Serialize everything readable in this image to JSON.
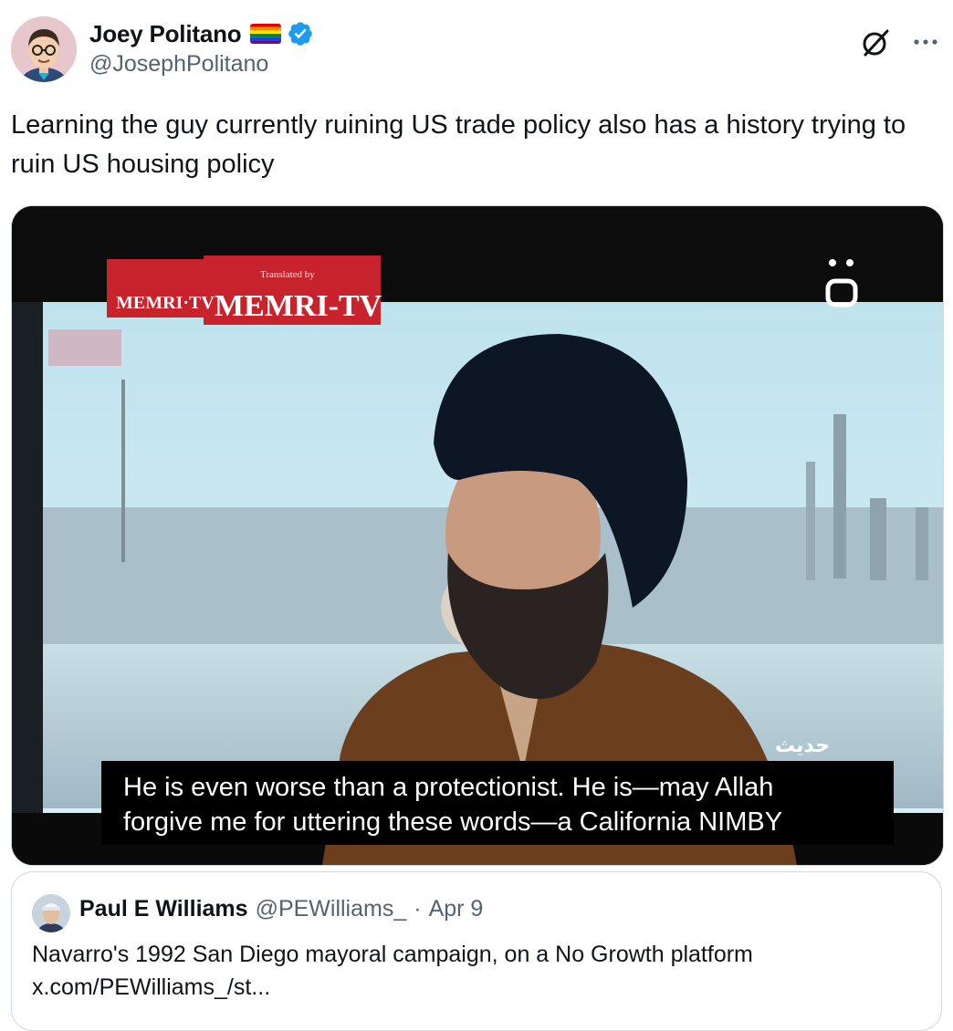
{
  "author": {
    "display_name": "Joey Politano",
    "handle": "@JosephPolitano"
  },
  "icons": {
    "flag": "rainbow-flag-icon",
    "verified": "verified-badge-icon",
    "grok": "grok-icon",
    "more": "more-options-icon"
  },
  "tweet": {
    "text": "Learning the guy currently ruining US trade policy also has a history trying to ruin US housing policy"
  },
  "media": {
    "logo_small_top": "Translated by",
    "logo_left": "MEMRI-TV",
    "logo_right": "MEMRI-TV",
    "channel_logo": "ö",
    "subtitle_line1": "He is even worse than a protectionist. He is—may Allah",
    "subtitle_line2": "forgive me for uttering these words—a California NIMBY",
    "arabic_caption": "حديث"
  },
  "quote": {
    "name": "Paul E Williams",
    "handle": "@PEWilliams_",
    "separator": "·",
    "date": "Apr 9",
    "text_line1": "Navarro's 1992 San Diego mayoral campaign, on a No Growth platform",
    "text_line2": "x.com/PEWilliams_/st..."
  },
  "colors": {
    "verified_blue": "#1d9bf0",
    "secondary_text": "#536471",
    "memri_red": "#c8232c"
  }
}
